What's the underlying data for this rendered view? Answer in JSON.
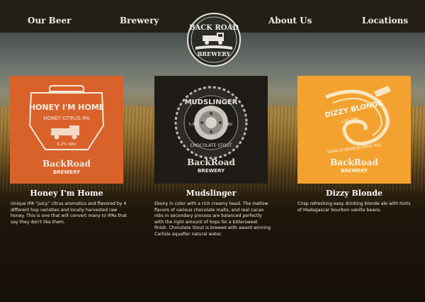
{
  "nav": {
    "items": [
      {
        "label": "Our Beer"
      },
      {
        "label": "Brewery"
      },
      {
        "label": "About Us"
      },
      {
        "label": "Locations"
      }
    ]
  },
  "logo": {
    "top_text": "BACK ROAD",
    "bottom_text": "BREWERY"
  },
  "beers": [
    {
      "name": "Honey I'm Home",
      "label_title": "HONEY I'M HOME",
      "label_style": "HONEY CITRUS IPA",
      "label_abv": "6.2% ABV",
      "label_brand": "BackRoad",
      "label_brewery": "BREWERY",
      "color": "#d9622b",
      "description": "Unique IPA \"juicy\" citrus aromatics and flavored by 4 different hop varieties and locally harvested raw honey. This is one that will convert many to IPAs that say they don't like them."
    },
    {
      "name": "Mudslinger",
      "label_title": "MUDSLINGER",
      "label_style": "CHOCOLATE STOUT",
      "label_abv_left": "5.5%",
      "label_abv_right": "ABV",
      "label_brand": "BackRoad",
      "label_brewery": "BREWERY",
      "color": "#1f1c17",
      "description": "Ebony in color with a rich creamy head. The mellow flavors of various chocolate malts, and real cacao nibs in secondary process are balanced perfectly with the right amount of hops for a bittersweet finish. Chocolate Stout is brewed with award winning Carlisle aquafier natural water."
    },
    {
      "name": "Dizzy Blonde",
      "label_title": "DIZZY BLONDE",
      "label_style": "VANILLA BEAN BLONDE ALE",
      "label_abv": "4.8% ABV",
      "label_brand": "BackRoad",
      "label_brewery": "BREWERY",
      "color": "#f4a22f",
      "description": "Crisp refreshing easy drinking blonde ale with hints of Madagascar bourbon vanilla beans."
    }
  ]
}
